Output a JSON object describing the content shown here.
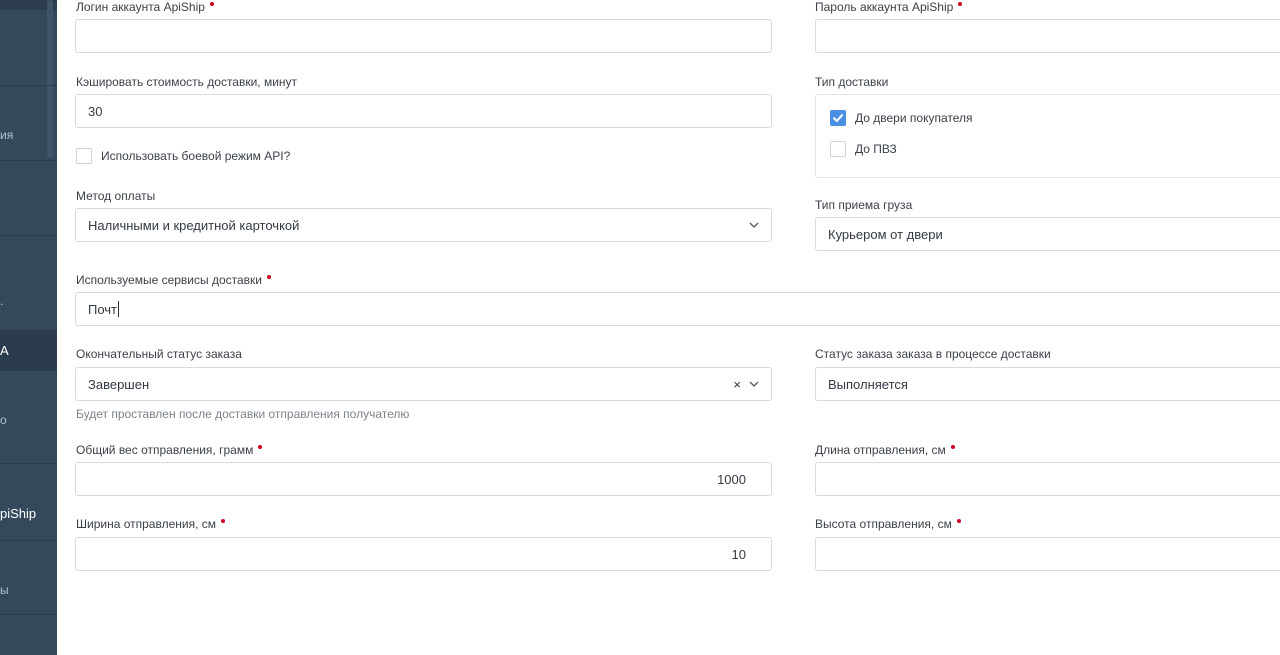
{
  "sidebar": {
    "items": [
      {
        "label": "ия"
      },
      {
        "label": "."
      },
      {
        "label": "A"
      },
      {
        "label": "о"
      },
      {
        "label": "piShip"
      },
      {
        "label": "ы"
      }
    ]
  },
  "form": {
    "login": {
      "label": "Логин аккаунта ApiShip",
      "value": ""
    },
    "password": {
      "label": "Пароль аккаунта ApiShip",
      "value": ""
    },
    "cache": {
      "label": "Кэшировать стоимость доставки, минут",
      "value": "30"
    },
    "delivery_type": {
      "label": "Тип доставки",
      "options": [
        {
          "label": "До двери покупателя",
          "checked": true
        },
        {
          "label": "До ПВЗ",
          "checked": false
        }
      ]
    },
    "live_mode": {
      "label": "Использовать боевой режим API?",
      "checked": false
    },
    "payment": {
      "label": "Метод оплаты",
      "value": "Наличными и кредитной карточкой"
    },
    "pickup_type": {
      "label": "Тип приема груза",
      "value": "Курьером от двери"
    },
    "services": {
      "label": "Используемые сервисы доставки",
      "value": "Почт"
    },
    "final_status": {
      "label": "Окончательный статус заказа",
      "value": "Завершен",
      "hint": "Будет проставлен после доставки отправления получателю"
    },
    "process_status": {
      "label": "Статус заказа заказа в процессе доставки",
      "value": "Выполняется"
    },
    "weight": {
      "label": "Общий вес отправления, грамм",
      "value": "1000"
    },
    "length": {
      "label": "Длина отправления, см",
      "value": ""
    },
    "width": {
      "label": "Ширина отправления, см",
      "value": "10"
    },
    "height": {
      "label": "Высота отправления, см",
      "value": ""
    }
  },
  "colors": {
    "sidebar_bg": "#34495c",
    "required": "#d0021b",
    "checkbox_checked": "#4a90e2"
  },
  "icons": {
    "chevron": "chevron-down-icon",
    "clear": "clear-icon",
    "check": "check-icon"
  }
}
